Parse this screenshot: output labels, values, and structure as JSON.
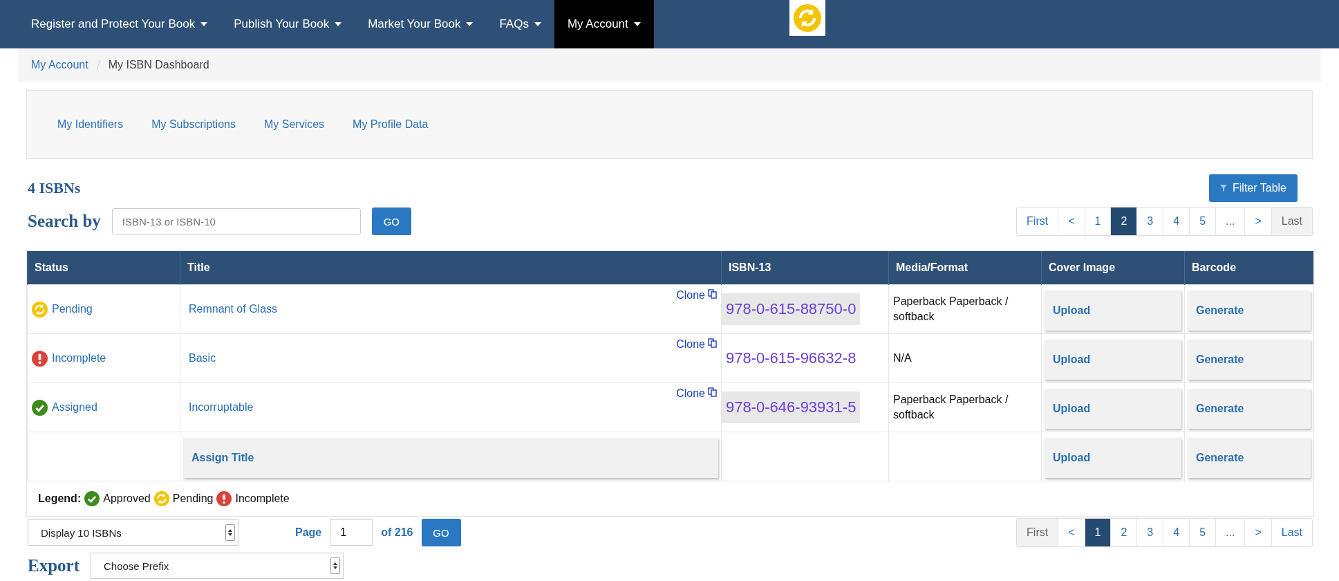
{
  "nav": {
    "items": [
      {
        "label": "Register and Protect Your Book",
        "selected": false
      },
      {
        "label": "Publish Your Book",
        "selected": false
      },
      {
        "label": "Market Your Book",
        "selected": false
      },
      {
        "label": "FAQs",
        "selected": false
      },
      {
        "label": "My Account",
        "selected": true
      }
    ]
  },
  "breadcrumb": [
    "My Account",
    "My ISBN Dashboard"
  ],
  "subnav": [
    "My Identifiers",
    "My Subscriptions",
    "My Services",
    "My Profile Data"
  ],
  "heading": "4 ISBNs",
  "filter_button": "Filter Table",
  "search": {
    "label": "Search by",
    "placeholder": "ISBN-13 or ISBN-10",
    "button": "GO"
  },
  "pagination_top": [
    {
      "label": "First",
      "selected": false,
      "disabled": false
    },
    {
      "label": "<",
      "selected": false,
      "disabled": false
    },
    {
      "label": "1",
      "selected": false,
      "disabled": false
    },
    {
      "label": "2",
      "selected": true,
      "disabled": false
    },
    {
      "label": "3",
      "selected": false,
      "disabled": false
    },
    {
      "label": "4",
      "selected": false,
      "disabled": false
    },
    {
      "label": "5",
      "selected": false,
      "disabled": false
    },
    {
      "label": "...",
      "selected": false,
      "disabled": false
    },
    {
      "label": ">",
      "selected": false,
      "disabled": false
    },
    {
      "label": "Last",
      "selected": false,
      "disabled": true
    }
  ],
  "table": {
    "columns": [
      "Status",
      "Title",
      "ISBN-13",
      "Media/Format",
      "Cover Image",
      "Barcode"
    ],
    "rows": [
      {
        "status": {
          "kind": "pending",
          "label": "Pending"
        },
        "title": "Remnant of Glass",
        "clone": "Clone",
        "isbn": "978-0-615-88750-0",
        "highlighted": true,
        "media": "Paperback Paperback / softback",
        "cover": "Upload",
        "barcode": "Generate"
      },
      {
        "status": {
          "kind": "incomplete",
          "label": "Incomplete"
        },
        "title": "Basic",
        "clone": "Clone",
        "isbn": "978-0-615-96632-8",
        "highlighted": false,
        "media": "N/A",
        "cover": "Upload",
        "barcode": "Generate"
      },
      {
        "status": {
          "kind": "assigned",
          "label": "Assigned"
        },
        "title": "Incorruptable",
        "clone": "Clone",
        "isbn": "978-0-646-93931-5",
        "highlighted": true,
        "media": "Paperback Paperback / softback",
        "cover": "Upload",
        "barcode": "Generate"
      },
      {
        "assign": "Assign Title",
        "cover": "Upload",
        "barcode": "Generate"
      }
    ]
  },
  "legend": {
    "label": "Legend:",
    "items": [
      {
        "kind": "assigned",
        "label": "Approved"
      },
      {
        "kind": "pending",
        "label": "Pending"
      },
      {
        "kind": "incomplete",
        "label": "Incomplete"
      }
    ]
  },
  "display_select": "Display 10 ISBNs",
  "page": {
    "label": "Page",
    "value": "1",
    "of": "of 216",
    "button": "GO"
  },
  "pagination_bottom": [
    {
      "label": "First",
      "selected": false,
      "disabled": true
    },
    {
      "label": "<",
      "selected": false,
      "disabled": false
    },
    {
      "label": "1",
      "selected": true,
      "disabled": false
    },
    {
      "label": "2",
      "selected": false,
      "disabled": false
    },
    {
      "label": "3",
      "selected": false,
      "disabled": false
    },
    {
      "label": "4",
      "selected": false,
      "disabled": false
    },
    {
      "label": "5",
      "selected": false,
      "disabled": false
    },
    {
      "label": "...",
      "selected": false,
      "disabled": false
    },
    {
      "label": ">",
      "selected": false,
      "disabled": false
    },
    {
      "label": "Last",
      "selected": false,
      "disabled": false
    }
  ],
  "export": {
    "label": "Export",
    "select": "Choose Prefix"
  }
}
